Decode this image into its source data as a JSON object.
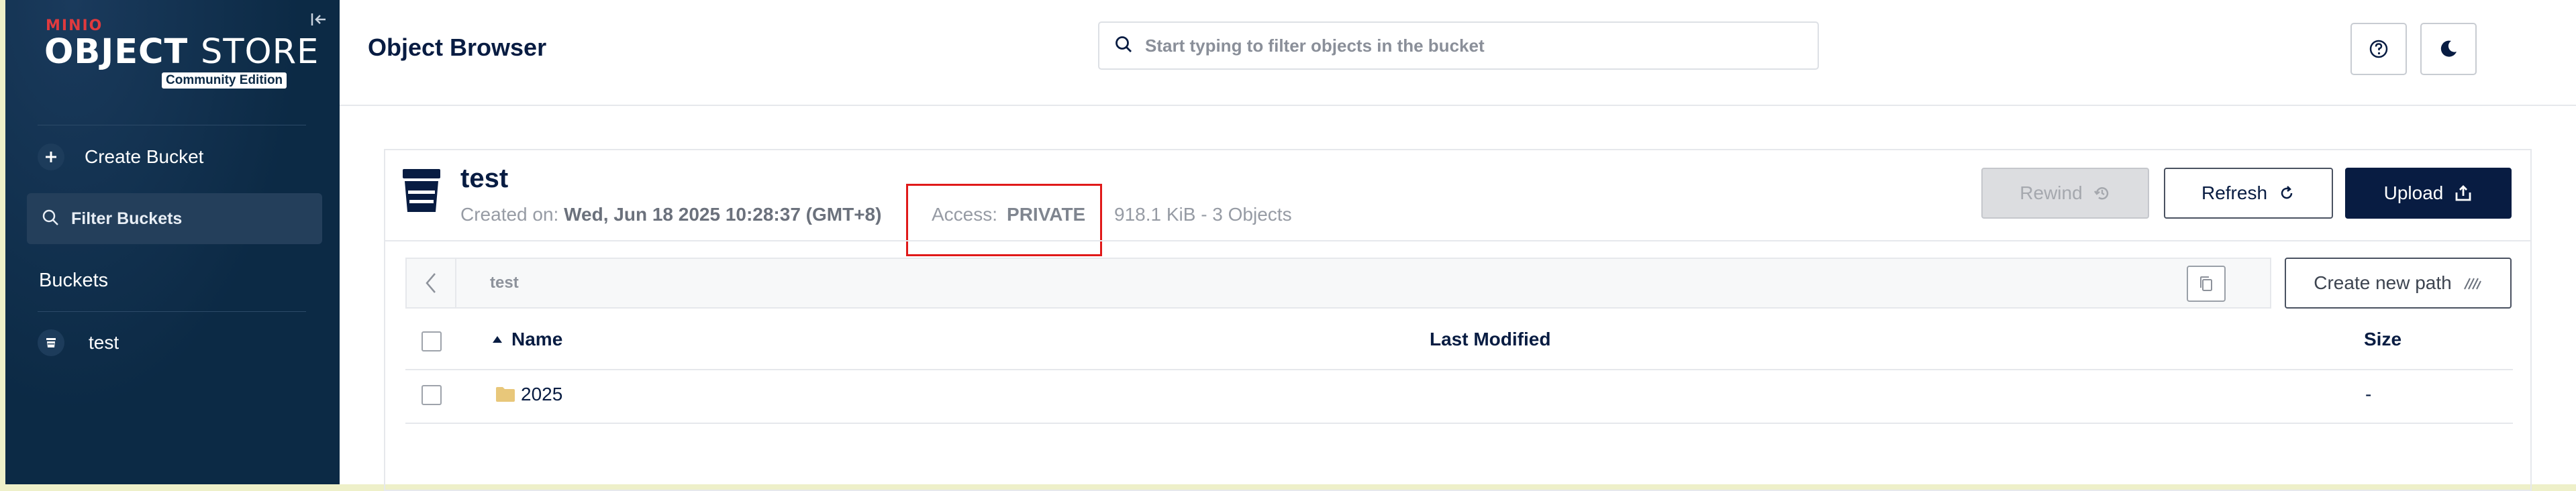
{
  "sidebar": {
    "brand": "MINIO",
    "product_bold": "OBJECT",
    "product_light": "STORE",
    "edition": "Community Edition",
    "create_bucket": "Create Bucket",
    "filter_buckets": "Filter Buckets",
    "buckets_title": "Buckets",
    "buckets": [
      {
        "label": "test"
      }
    ]
  },
  "header": {
    "title": "Object Browser",
    "search_placeholder": "Start typing to filter objects in the bucket"
  },
  "bucket": {
    "name": "test",
    "created_label": "Created on:",
    "created_value": "Wed, Jun 18 2025 10:28:37 (GMT+8)",
    "access_label": "Access:",
    "access_value": "PRIVATE",
    "usage": "918.1 KiB - 3 Objects"
  },
  "actions": {
    "rewind": "Rewind",
    "refresh": "Refresh",
    "upload": "Upload",
    "create_path": "Create new path"
  },
  "breadcrumb": {
    "path": "test"
  },
  "table": {
    "columns": [
      "Name",
      "Last Modified",
      "Size"
    ],
    "sort_column": "Name",
    "sort_direction": "asc",
    "rows": [
      {
        "name": "2025",
        "type": "folder",
        "last_modified": "",
        "size": "-"
      }
    ]
  },
  "colors": {
    "sidebar_bg": "#0c2a45",
    "primary": "#081c42",
    "brand_red": "#e03a3e",
    "highlight": "#e01919",
    "folder": "#e8c77a"
  }
}
